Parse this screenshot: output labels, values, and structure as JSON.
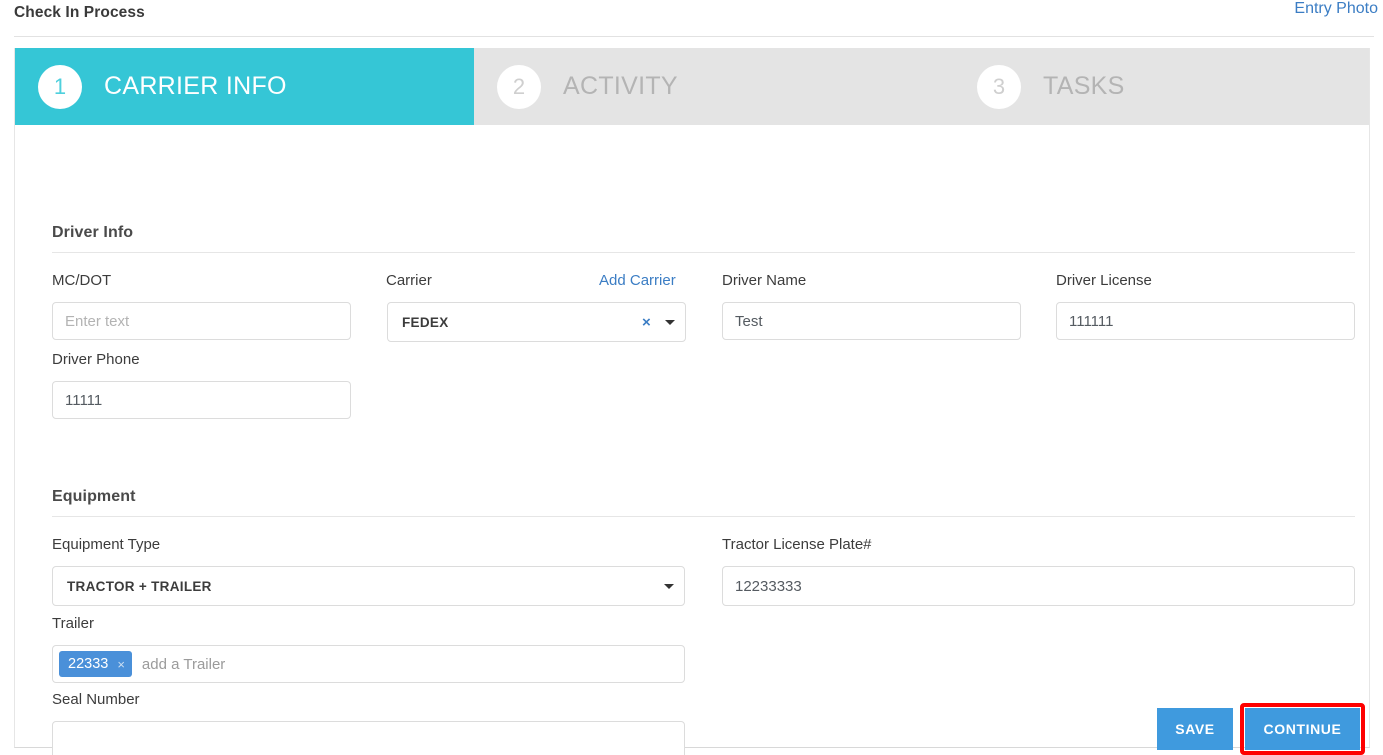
{
  "header": {
    "title": "Check In Process",
    "entry_photo_label": "Entry Photo"
  },
  "stepper": {
    "steps": [
      {
        "number": "1",
        "label": "CARRIER INFO",
        "active": true
      },
      {
        "number": "2",
        "label": "ACTIVITY",
        "active": false
      },
      {
        "number": "3",
        "label": "TASKS",
        "active": false
      }
    ]
  },
  "driver_info": {
    "section_title": "Driver Info",
    "mc_dot": {
      "label": "MC/DOT",
      "value": "",
      "placeholder": "Enter text"
    },
    "carrier": {
      "label": "Carrier",
      "add_link": "Add Carrier",
      "value": "FEDEX",
      "clear_icon": "×",
      "dropdown_icon": "chevron-down-icon"
    },
    "driver_name": {
      "label": "Driver Name",
      "value": "Test"
    },
    "driver_license": {
      "label": "Driver License",
      "value": "111111"
    },
    "driver_phone": {
      "label": "Driver Phone",
      "value": "11111"
    }
  },
  "equipment": {
    "section_title": "Equipment",
    "equipment_type": {
      "label": "Equipment Type",
      "value": "TRACTOR + TRAILER",
      "dropdown_icon": "chevron-down-icon"
    },
    "tractor_license_plate": {
      "label": "Tractor License Plate#",
      "value": "12233333"
    },
    "trailer": {
      "label": "Trailer",
      "chips": [
        {
          "value": "22333",
          "remove_icon": "×"
        }
      ],
      "placeholder": "add a Trailer"
    },
    "seal_number": {
      "label": "Seal Number",
      "value": ""
    }
  },
  "actions": {
    "save_label": "SAVE",
    "continue_label": "CONTINUE"
  },
  "colors": {
    "accent_teal": "#35c6d6",
    "primary_blue": "#3f9ade",
    "link_blue": "#3b7dc4",
    "highlight_red": "#fe0000",
    "chip_blue": "#4a90d9",
    "inactive_grey": "#e4e4e4"
  }
}
